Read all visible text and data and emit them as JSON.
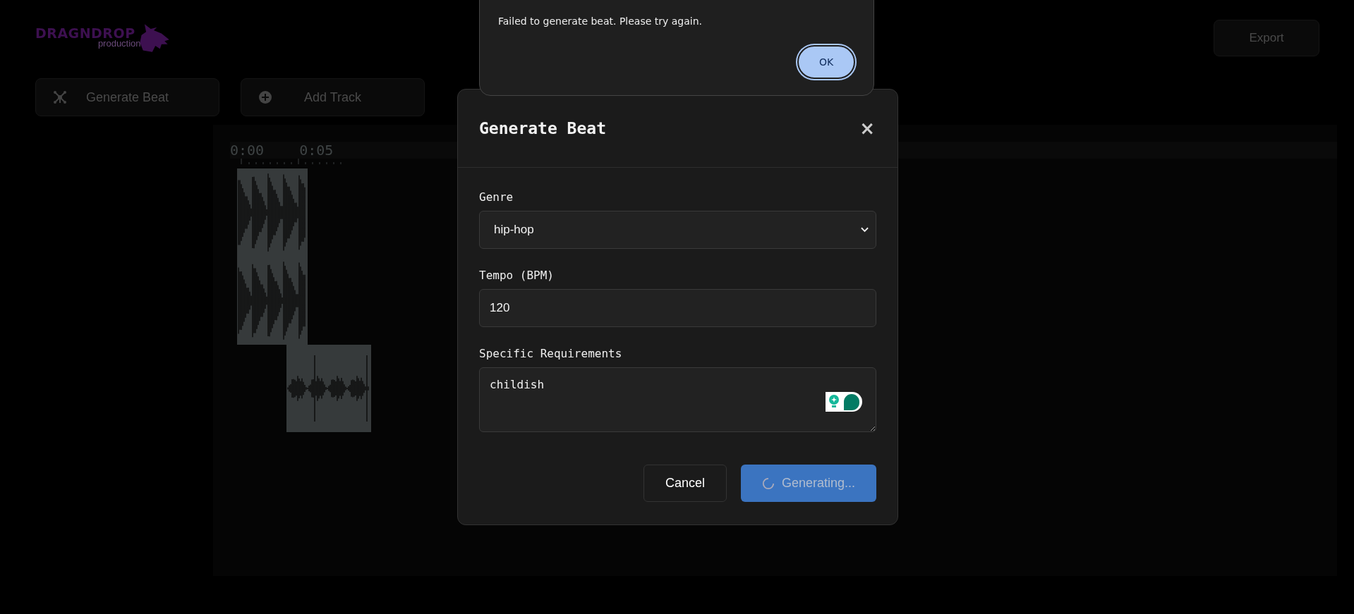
{
  "header": {
    "logo": {
      "wordmark": "DRAGNDROP",
      "tagline": "production"
    },
    "export_button": "Export"
  },
  "toolbar": [
    {
      "kind": "generate",
      "label": "Generate Beat"
    },
    {
      "kind": "add",
      "label": "Add Track"
    }
  ],
  "timeline": {
    "ticks": [
      "0:00",
      "0:05"
    ]
  },
  "modal": {
    "title": "Generate Beat",
    "close": "×",
    "fields": [
      {
        "kind": "select",
        "label": "Genre",
        "value": "hip-hop"
      },
      {
        "kind": "number",
        "label": "Tempo (BPM)",
        "value": "120"
      },
      {
        "kind": "textarea",
        "label": "Specific Requirements",
        "value": "childish"
      }
    ],
    "buttons": [
      {
        "kind": "secondary",
        "label": "Cancel",
        "loading": false
      },
      {
        "kind": "primary",
        "label": "Generating...",
        "loading": true
      }
    ]
  },
  "alert": {
    "message": "Failed to generate beat. Please try again.",
    "button": "OK"
  }
}
